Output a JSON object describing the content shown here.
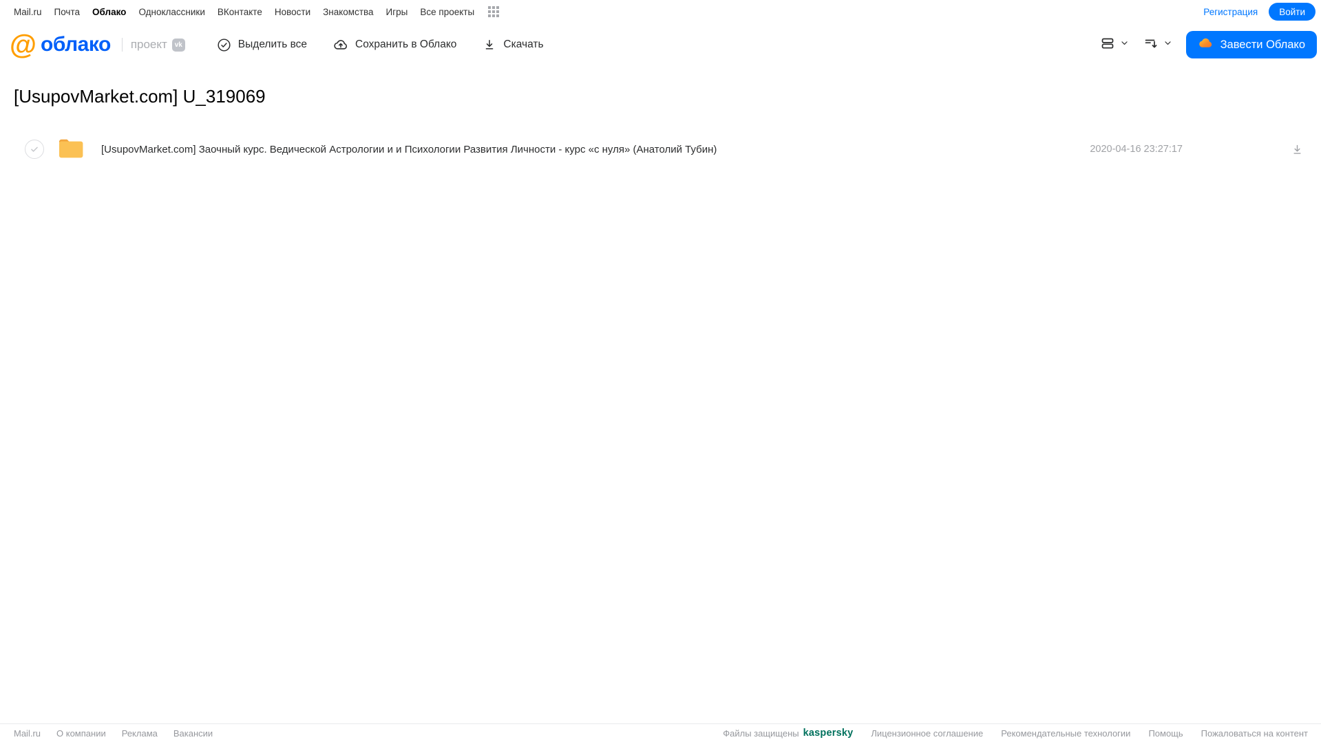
{
  "topnav": {
    "links": [
      "Mail.ru",
      "Почта",
      "Облако",
      "Одноклассники",
      "ВКонтакте",
      "Новости",
      "Знакомства",
      "Игры",
      "Все проекты"
    ],
    "registration": "Регистрация",
    "login": "Войти"
  },
  "header": {
    "logo_at": "@",
    "logo_text": "облако",
    "project_label": "проект",
    "vk_badge": "vk",
    "toolbar": {
      "select_all": "Выделить все",
      "save_to_cloud": "Сохранить в Облако",
      "download": "Скачать"
    },
    "get_cloud_button": "Завести Облако"
  },
  "main": {
    "title": "[UsupovMarket.com] U_319069",
    "files": [
      {
        "name": "[UsupovMarket.com] Заочный курс. Ведической Астрологии и и Психологии Развития Личности - курс «с нуля» (Анатолий Тубин)",
        "date": "2020-04-16 23:27:17",
        "type": "folder"
      }
    ]
  },
  "footer": {
    "left_links": [
      "Mail.ru",
      "О компании",
      "Реклама",
      "Вакансии"
    ],
    "protected_text": "Файлы защищены",
    "kaspersky_logo": "kaspersky",
    "right_links": [
      "Лицензионное соглашение",
      "Рекомендательные технологии",
      "Помощь",
      "Пожаловаться на контент"
    ]
  },
  "colors": {
    "accent_blue": "#0077ff",
    "logo_blue": "#005ff9",
    "logo_orange": "#ff9e00",
    "folder_yellow": "#fbc154",
    "kaspersky_green": "#00715d",
    "muted_gray": "#a0a2a6"
  },
  "icons": {
    "grid": "3x3-dots-apps-grid",
    "check_circle": "circle-with-checkmark",
    "cloud_upload": "cloud-with-up-arrow",
    "download": "down-arrow-with-bar",
    "view_rows": "two-stacked-rounded-rects",
    "sort": "lines-with-down-arrow",
    "chevron": "chevron-down",
    "cloud": "orange-cloud"
  }
}
